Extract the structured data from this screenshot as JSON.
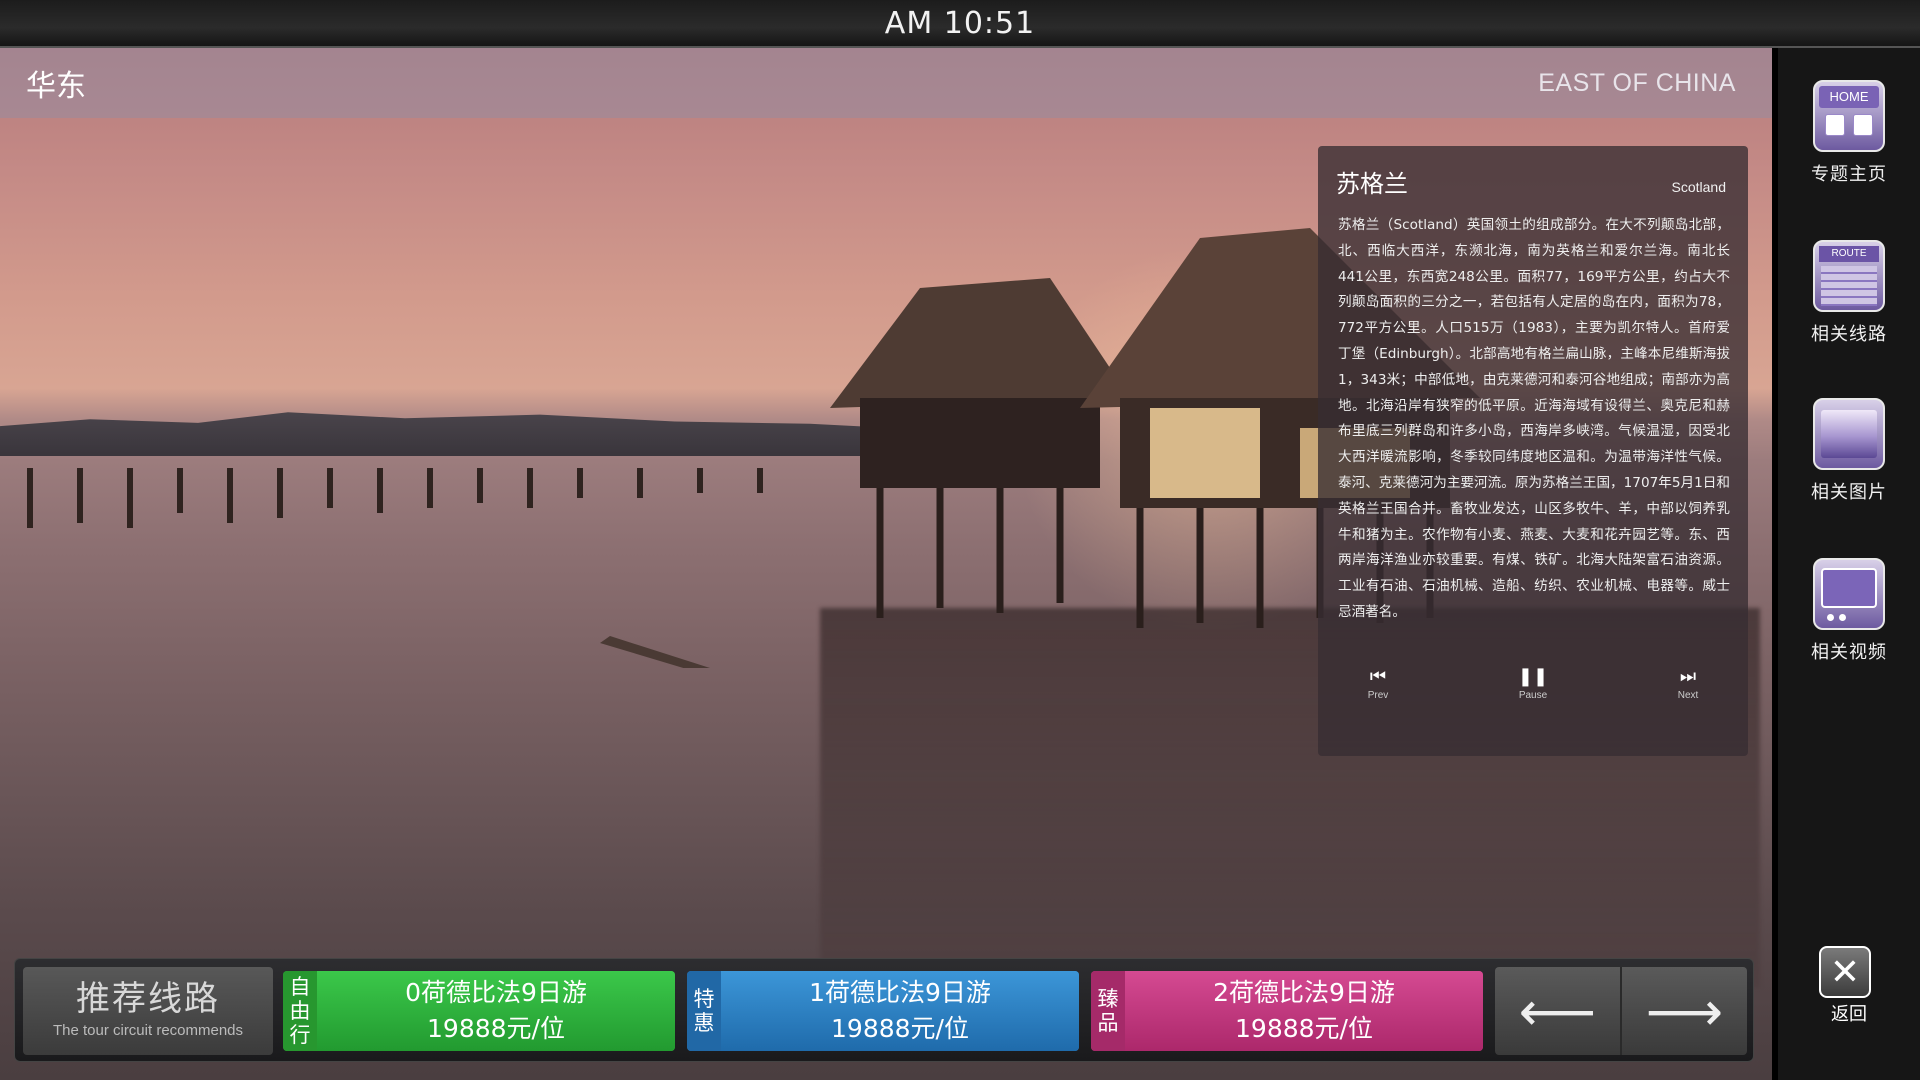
{
  "status_bar": {
    "time": "AM  10:51"
  },
  "header": {
    "title": "华东",
    "subtitle": "EAST OF CHINA"
  },
  "info_panel": {
    "name": "苏格兰",
    "english_name": "Scotland",
    "description": "苏格兰（Scotland）英国领土的组成部分。在大不列颠岛北部，北、西临大西洋，东濒北海，南为英格兰和爱尔兰海。南北长441公里，东西宽248公里。面积77，169平方公里，约占大不列颠岛面积的三分之一，若包括有人定居的岛在内，面积为78，772平方公里。人口515万（1983），主要为凯尔特人。首府爱丁堡（Edinburgh）。北部高地有格兰扁山脉，主峰本尼维斯海拔1，343米；中部低地，由克莱德河和泰河谷地组成；南部亦为高地。北海沿岸有狭窄的低平原。近海海域有设得兰、奥克尼和赫布里底三列群岛和许多小岛，西海岸多峡湾。气候温湿，因受北大西洋暖流影响，冬季较同纬度地区温和。为温带海洋性气候。泰河、克莱德河为主要河流。原为苏格兰王国，1707年5月1日和英格兰王国合并。畜牧业发达，山区多牧牛、羊，中部以饲养乳牛和猪为主。农作物有小麦、燕麦、大麦和花卉园艺等。东、西两岸海洋渔业亦较重要。有煤、铁矿。北海大陆架富石油资源。工业有石油、石油机械、造船、纺织、农业机械、电器等。威士忌酒著名。",
    "controls": {
      "prev": "Prev",
      "pause": "Pause",
      "next": "Next"
    }
  },
  "route_bar": {
    "recommend_cn": "推荐线路",
    "recommend_en": "The tour circuit recommends",
    "routes": [
      {
        "tag": [
          "自",
          "由",
          "行"
        ],
        "name": "0荷德比法9日游",
        "price": "19888元/位",
        "color": "#2fb33e"
      },
      {
        "tag": [
          "特",
          "惠"
        ],
        "name": "1荷德比法9日游",
        "price": "19888元/位",
        "color": "#2a7fc2"
      },
      {
        "tag": [
          "臻",
          "品"
        ],
        "name": "2荷德比法9日游",
        "price": "19888元/位",
        "color": "#c2327c"
      }
    ]
  },
  "sidebar": {
    "items": [
      {
        "label": "专题主页",
        "icon": "home-icon",
        "icon_text": "HOME"
      },
      {
        "label": "相关线路",
        "icon": "route-icon",
        "icon_text": "ROUTE"
      },
      {
        "label": "相关图片",
        "icon": "picture-icon"
      },
      {
        "label": "相关视频",
        "icon": "video-icon"
      }
    ],
    "close_label": "返回"
  }
}
